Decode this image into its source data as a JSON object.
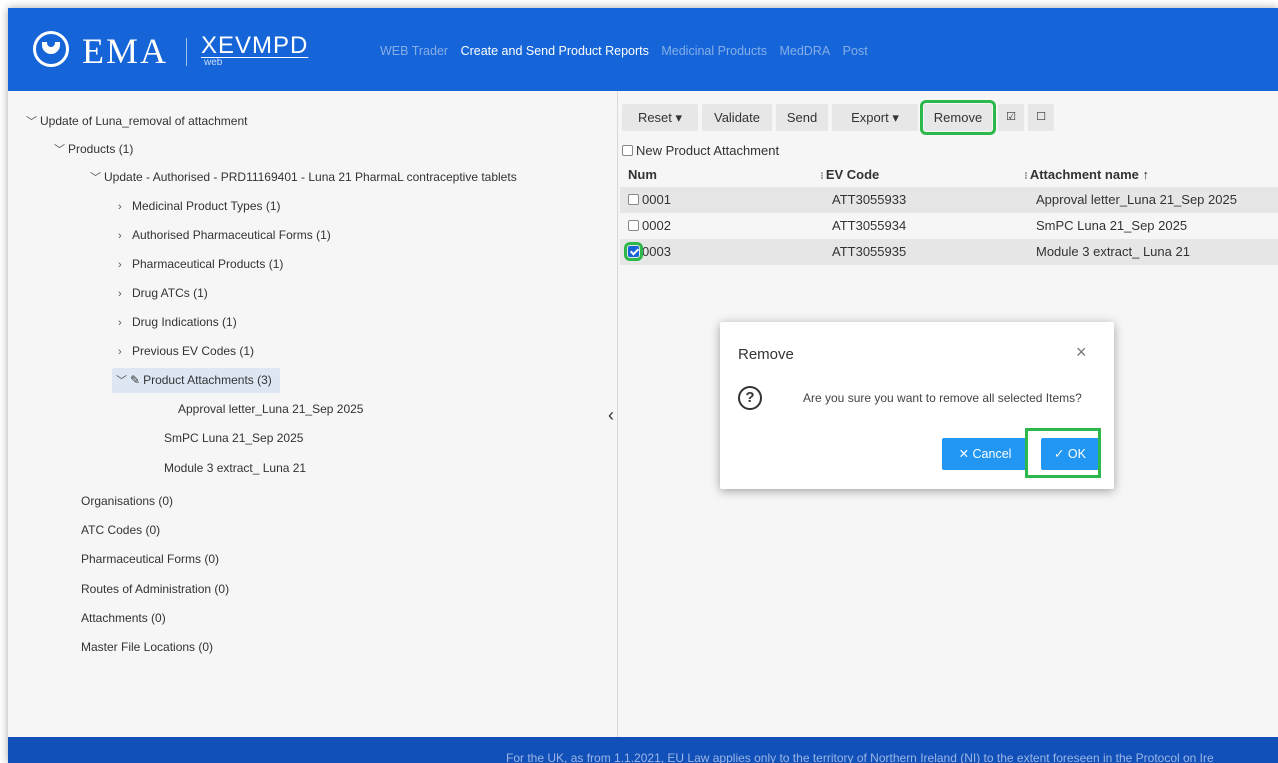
{
  "header": {
    "logo_text": "EMA",
    "app_name": "XEVMPD",
    "app_sub": "web",
    "nav": [
      {
        "label": "WEB Trader",
        "active": false
      },
      {
        "label": "Create and Send Product Reports",
        "active": true
      },
      {
        "label": "Medicinal Products",
        "active": false
      },
      {
        "label": "MedDRA",
        "active": false
      },
      {
        "label": "Post",
        "active": false
      }
    ]
  },
  "tree": {
    "root": "Update of Luna_removal of attachment",
    "products": "Products (1)",
    "product_update": "Update - Authorised - PRD11169401 - Luna 21 PharmaL contraceptive tablets",
    "children": [
      "Medicinal Product Types (1)",
      "Authorised Pharmaceutical Forms (1)",
      "Pharmaceutical Products (1)",
      "Drug ATCs (1)",
      "Drug Indications (1)",
      "Previous EV Codes (1)"
    ],
    "attachments_folder": "Product Attachments (3)",
    "attachments": [
      "Approval letter_Luna 21_Sep 2025",
      "SmPC Luna 21_Sep 2025",
      "Module 3 extract_ Luna 21"
    ],
    "sections": [
      "Organisations (0)",
      "ATC Codes (0)",
      "Pharmaceutical Forms (0)",
      "Routes of Administration (0)",
      "Attachments (0)",
      "Master File Locations (0)"
    ]
  },
  "toolbar": {
    "reset": "Reset",
    "validate": "Validate",
    "send": "Send",
    "export": "Export",
    "remove": "Remove",
    "select_all": "☑",
    "deselect_all": "☐",
    "dropdown_caret": "▾"
  },
  "table": {
    "new_attachment": "New Product Attachment",
    "headers": {
      "num": "Num",
      "ev_code": "EV Code",
      "name": "Attachment name ↑"
    },
    "rows": [
      {
        "num": "0001",
        "ev_code": "ATT3055933",
        "name": "Approval letter_Luna 21_Sep 2025",
        "checked": false
      },
      {
        "num": "0002",
        "ev_code": "ATT3055934",
        "name": "SmPC Luna 21_Sep 2025",
        "checked": false
      },
      {
        "num": "0003",
        "ev_code": "ATT3055935",
        "name": "Module 3 extract_ Luna 21",
        "checked": true
      }
    ]
  },
  "modal": {
    "title": "Remove",
    "close": "×",
    "question_icon": "?",
    "message": "Are you sure you want to remove all selected Items?",
    "cancel": "✕ Cancel",
    "ok": "✓ OK"
  },
  "footer": {
    "text": "For the UK, as from 1.1.2021, EU Law applies only to the territory of Northern Ireland (NI) to the extent foreseen in the Protocol on Ire"
  },
  "colors": {
    "header_bg": "#1565d8",
    "footer_bg": "#1150b8",
    "highlight": "#2db84b",
    "button_blue": "#2196f3"
  }
}
